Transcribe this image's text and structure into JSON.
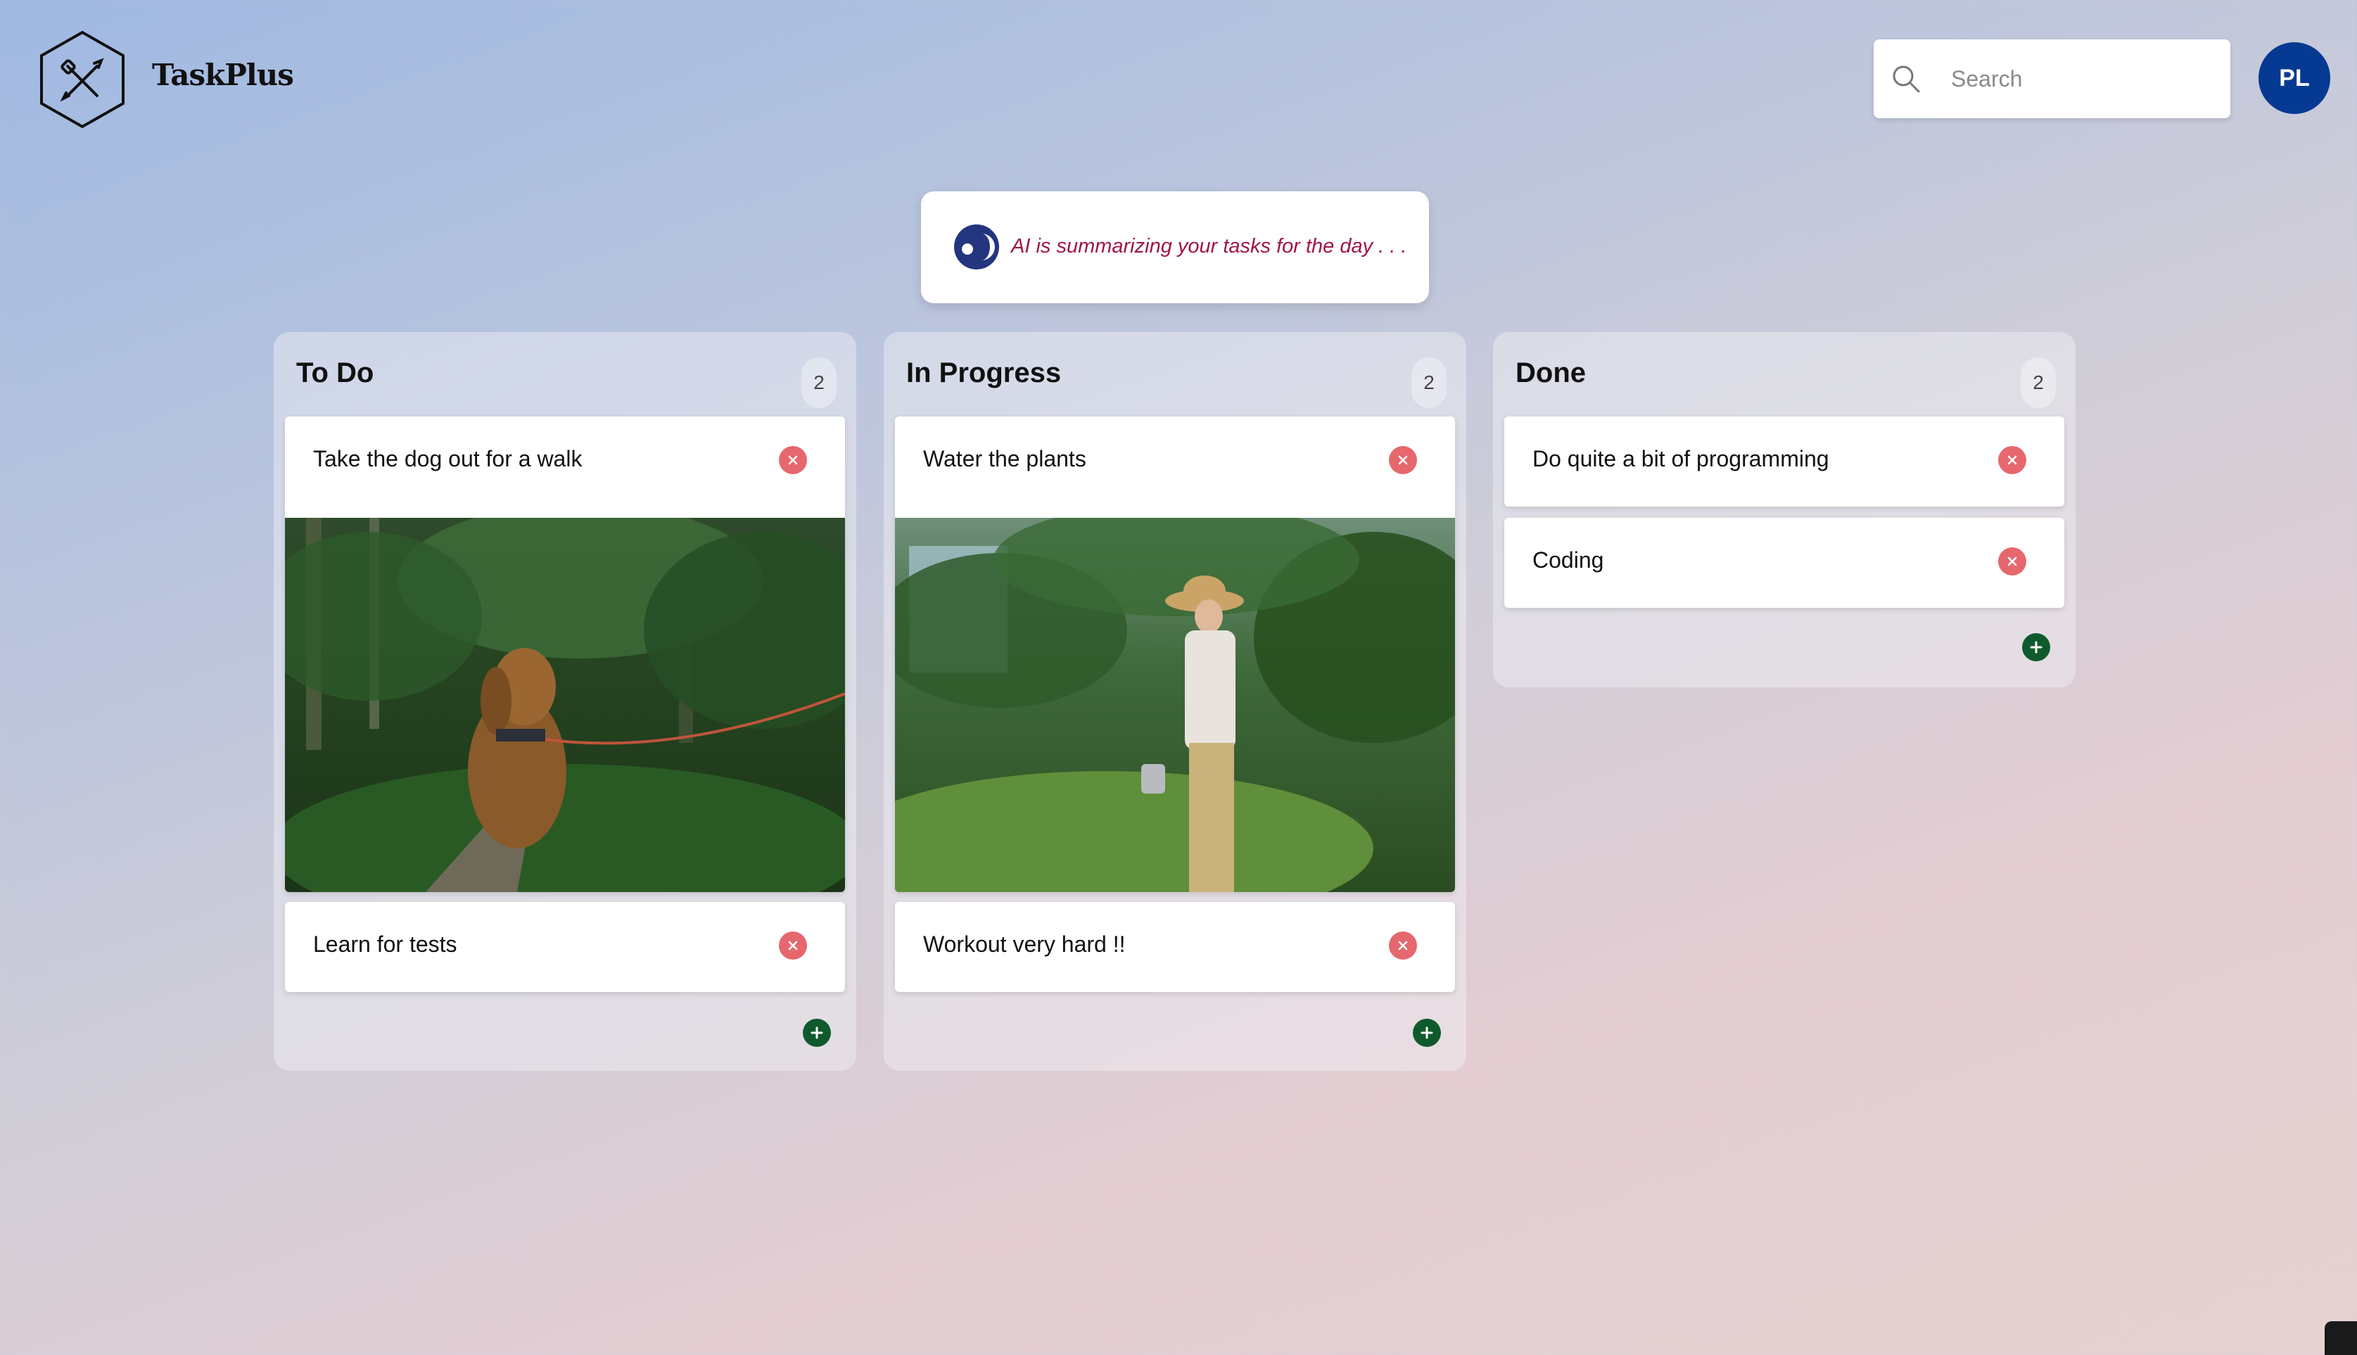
{
  "header": {
    "brand": "TaskPlus",
    "logo_icon": "crossed-tools-hexagon-icon",
    "search": {
      "placeholder": "Search",
      "icon": "search-icon"
    },
    "avatar_initials": "PL"
  },
  "ai_banner": {
    "icon": "ai-assistant-icon",
    "text": "AI is summarizing your tasks for the day . . ."
  },
  "colors": {
    "accent": "#063a92",
    "ai_text": "#a0154a",
    "delete": "#e6676e",
    "add": "#0f5a2c"
  },
  "columns": [
    {
      "title": "To Do",
      "count": "2",
      "cards": [
        {
          "title": "Take the dog out for a walk",
          "image": "dog-in-forest"
        },
        {
          "title": "Learn for tests"
        }
      ]
    },
    {
      "title": "In Progress",
      "count": "2",
      "cards": [
        {
          "title": "Water the plants",
          "image": "woman-watering-plants"
        },
        {
          "title": "Workout very hard !!"
        }
      ]
    },
    {
      "title": "Done",
      "count": "2",
      "cards": [
        {
          "title": "Do quite a bit of programming"
        },
        {
          "title": "Coding"
        }
      ]
    }
  ]
}
